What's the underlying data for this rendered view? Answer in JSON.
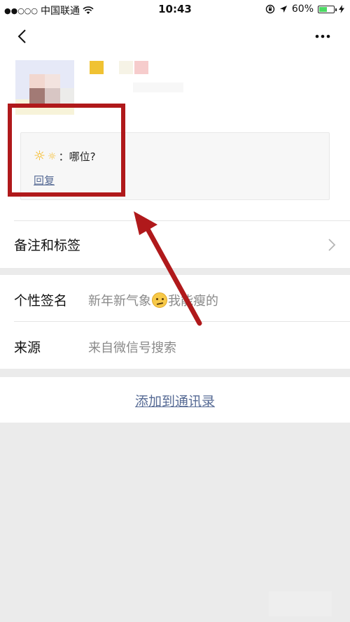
{
  "status_bar": {
    "signal": "●●○○○",
    "carrier": "中国联通",
    "time": "10:43",
    "battery_percent": "60%",
    "battery_level": 0.6,
    "icons": [
      "wifi-icon",
      "orientation-lock-icon",
      "location-arrow-icon",
      "battery-icon",
      "charging-bolt-icon"
    ]
  },
  "nav": {
    "back_icon": "chevron-left-icon",
    "more_icon": "ellipsis-icon"
  },
  "greeting": {
    "message": "：哪位?",
    "reply_label": "回复"
  },
  "rows": {
    "tags_label": "备注和标签"
  },
  "profile_details": {
    "signature_label": "个性签名",
    "signature_before": "新年新气象",
    "signature_after": "我能瘦的",
    "source_label": "来源",
    "source_value": "来自微信号搜索"
  },
  "actions": {
    "add_contact_label": "添加到通讯录"
  },
  "colors": {
    "highlight": "#b0191b",
    "link": "#576b95",
    "sun": "#f5b820"
  }
}
